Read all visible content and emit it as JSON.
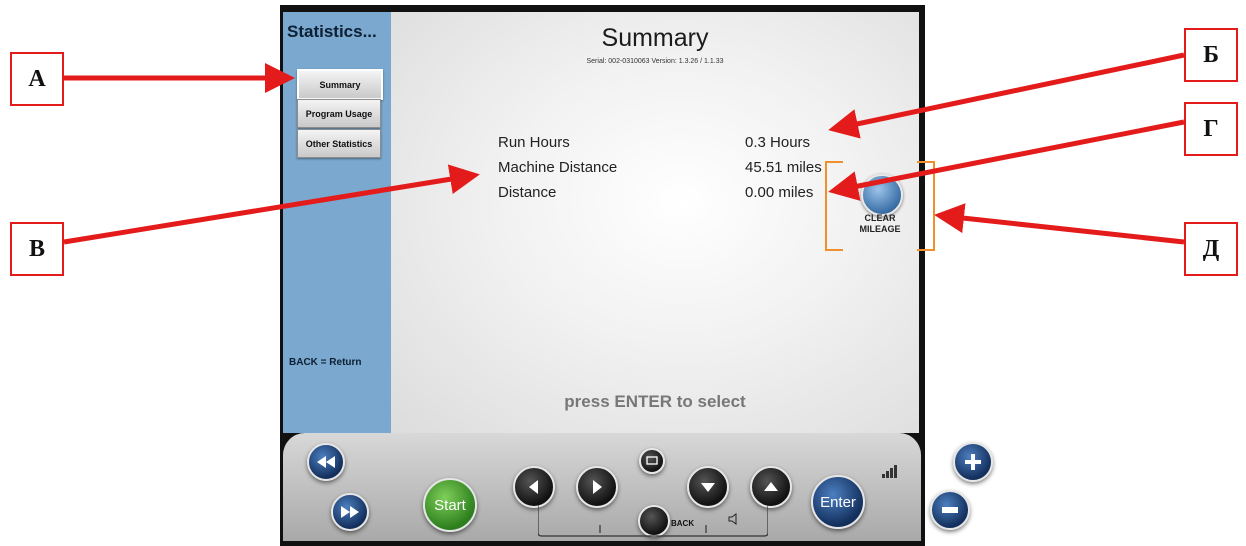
{
  "sidebar": {
    "title": "Statistics...",
    "items": [
      {
        "label": "Summary"
      },
      {
        "label": "Program Usage"
      },
      {
        "label": "Other Statistics"
      }
    ],
    "back_hint": "BACK = Return"
  },
  "main": {
    "title": "Summary",
    "serial": "Serial: 002-0310063  Version: 1.3.26 / 1.1.33",
    "stats": [
      {
        "label": "Run Hours",
        "value": "0.3 Hours"
      },
      {
        "label": "Machine Distance",
        "value": "45.51 miles"
      },
      {
        "label": "Distance",
        "value": "0.00 miles"
      }
    ],
    "clear_mileage": "CLEAR\nMILEAGE",
    "hint": "press ENTER to select"
  },
  "console": {
    "start": "Start",
    "enter": "Enter",
    "back": "BACK"
  },
  "callouts": {
    "a": "А",
    "b": "Б",
    "v": "В",
    "g": "Г",
    "d": "Д"
  },
  "colors": {
    "sidebar": "#7aa8cf",
    "accent": "#f0902a",
    "callout": "#e41b1b"
  }
}
